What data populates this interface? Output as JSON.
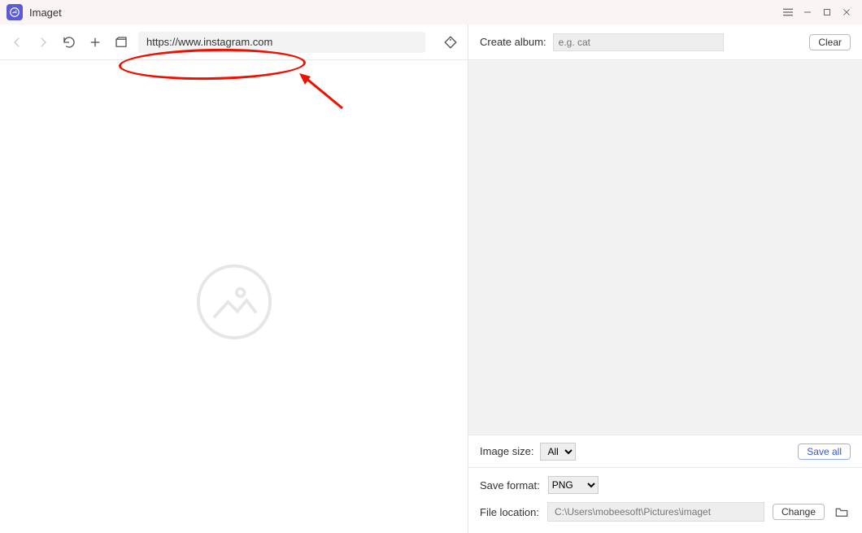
{
  "title": "Imaget",
  "toolbar": {
    "url_value": "https://www.instagram.com"
  },
  "right": {
    "create_album_label": "Create album:",
    "create_album_placeholder": "e.g. cat",
    "clear_label": "Clear",
    "image_size_label": "Image size:",
    "image_size_value": "All",
    "save_all_label": "Save all",
    "save_format_label": "Save format:",
    "save_format_value": "PNG",
    "file_location_label": "File location:",
    "file_location_value": "C:\\Users\\mobeesoft\\Pictures\\imaget",
    "change_label": "Change"
  }
}
